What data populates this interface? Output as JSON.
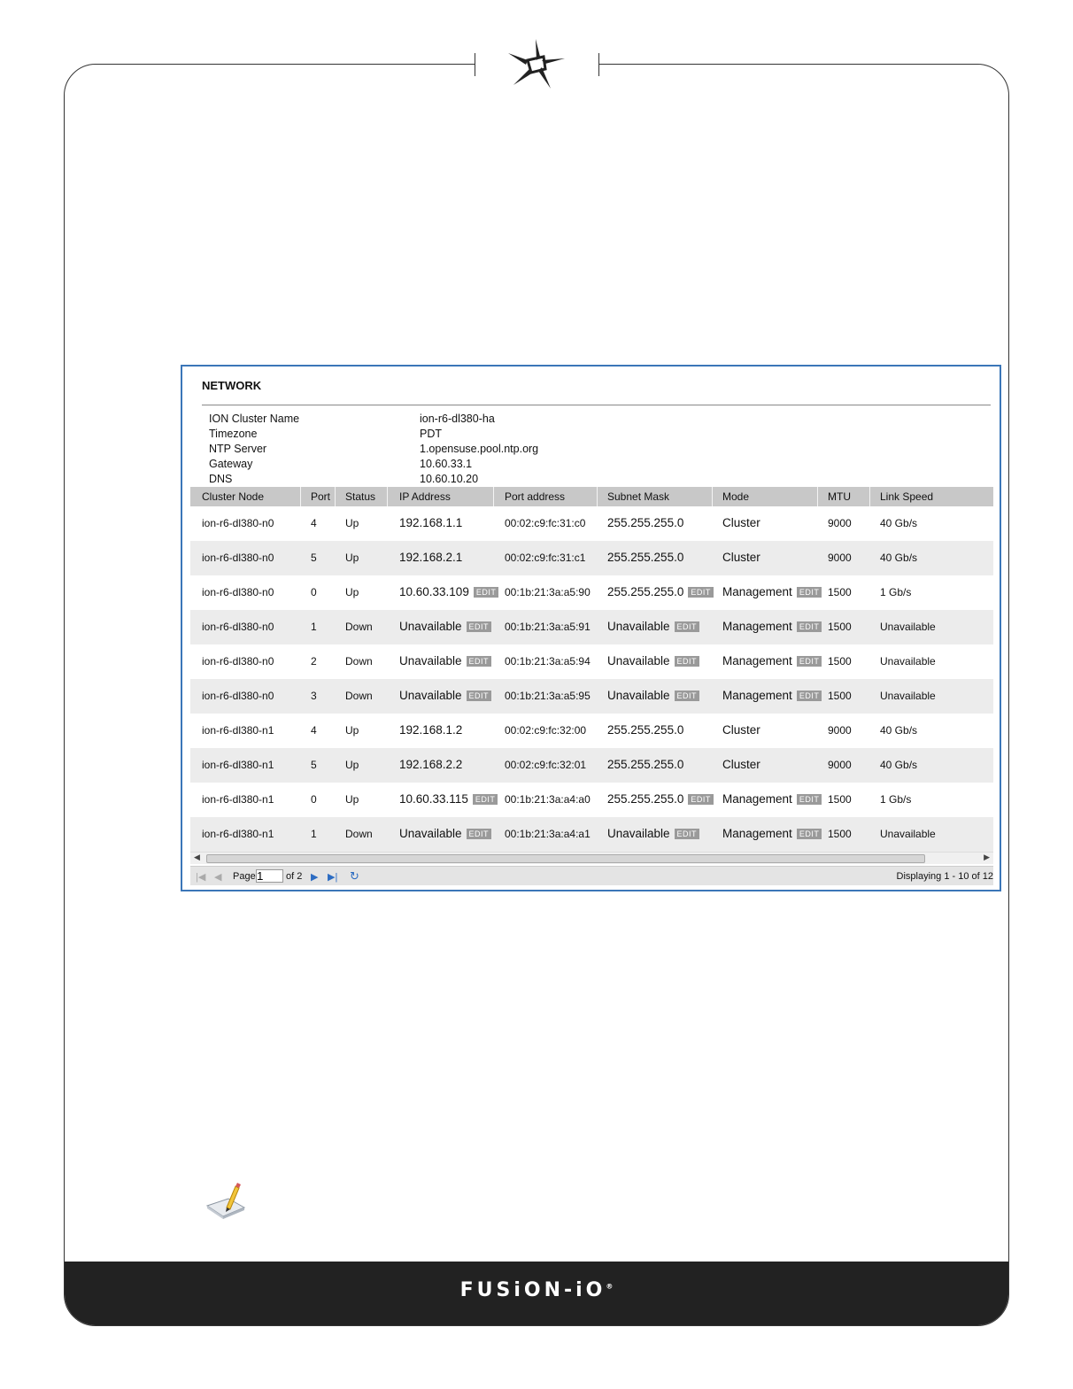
{
  "network": {
    "title": "NETWORK",
    "info": [
      {
        "label": "ION Cluster Name",
        "value": "ion-r6-dl380-ha"
      },
      {
        "label": "Timezone",
        "value": "PDT"
      },
      {
        "label": "NTP Server",
        "value": "1.opensuse.pool.ntp.org"
      },
      {
        "label": "Gateway",
        "value": "10.60.33.1"
      },
      {
        "label": "DNS",
        "value": "10.60.10.20"
      }
    ],
    "columns": [
      "Cluster Node",
      "Port",
      "Status",
      "IP Address",
      "Port address",
      "Subnet Mask",
      "Mode",
      "MTU",
      "Link Speed"
    ],
    "edit_label": "EDIT",
    "rows": [
      {
        "node": "ion-r6-dl380-n0",
        "port": "4",
        "status": "Up",
        "ip": "192.168.1.1",
        "mac": "00:02:c9:fc:31:c0",
        "mask": "255.255.255.0",
        "mode": "Cluster",
        "mtu": "9000",
        "speed": "40 Gb/s"
      },
      {
        "node": "ion-r6-dl380-n0",
        "port": "5",
        "status": "Up",
        "ip": "192.168.2.1",
        "mac": "00:02:c9:fc:31:c1",
        "mask": "255.255.255.0",
        "mode": "Cluster",
        "mtu": "9000",
        "speed": "40 Gb/s"
      },
      {
        "node": "ion-r6-dl380-n0",
        "port": "0",
        "status": "Up",
        "ip": "10.60.33.109",
        "mac": "00:1b:21:3a:a5:90",
        "mask": "255.255.255.0",
        "mode": "Management",
        "mtu": "1500",
        "speed": "1 Gb/s"
      },
      {
        "node": "ion-r6-dl380-n0",
        "port": "1",
        "status": "Down",
        "ip": "Unavailable",
        "mac": "00:1b:21:3a:a5:91",
        "mask": "Unavailable",
        "mode": "Management",
        "mtu": "1500",
        "speed": "Unavailable"
      },
      {
        "node": "ion-r6-dl380-n0",
        "port": "2",
        "status": "Down",
        "ip": "Unavailable",
        "mac": "00:1b:21:3a:a5:94",
        "mask": "Unavailable",
        "mode": "Management",
        "mtu": "1500",
        "speed": "Unavailable"
      },
      {
        "node": "ion-r6-dl380-n0",
        "port": "3",
        "status": "Down",
        "ip": "Unavailable",
        "mac": "00:1b:21:3a:a5:95",
        "mask": "Unavailable",
        "mode": "Management",
        "mtu": "1500",
        "speed": "Unavailable"
      },
      {
        "node": "ion-r6-dl380-n1",
        "port": "4",
        "status": "Up",
        "ip": "192.168.1.2",
        "mac": "00:02:c9:fc:32:00",
        "mask": "255.255.255.0",
        "mode": "Cluster",
        "mtu": "9000",
        "speed": "40 Gb/s"
      },
      {
        "node": "ion-r6-dl380-n1",
        "port": "5",
        "status": "Up",
        "ip": "192.168.2.2",
        "mac": "00:02:c9:fc:32:01",
        "mask": "255.255.255.0",
        "mode": "Cluster",
        "mtu": "9000",
        "speed": "40 Gb/s"
      },
      {
        "node": "ion-r6-dl380-n1",
        "port": "0",
        "status": "Up",
        "ip": "10.60.33.115",
        "mac": "00:1b:21:3a:a4:a0",
        "mask": "255.255.255.0",
        "mode": "Management",
        "mtu": "1500",
        "speed": "1 Gb/s"
      },
      {
        "node": "ion-r6-dl380-n1",
        "port": "1",
        "status": "Down",
        "ip": "Unavailable",
        "mac": "00:1b:21:3a:a4:a1",
        "mask": "Unavailable",
        "mode": "Management",
        "mtu": "1500",
        "speed": "Unavailable"
      }
    ],
    "pager": {
      "page_label": "Page",
      "page_value": "1",
      "of_label": "of 2",
      "display_text": "Displaying 1 - 10 of 12"
    }
  },
  "footer": {
    "logo_text": "FUSiON-iO",
    "registered": "®"
  },
  "icons": [
    "fusion-io-logo-icon",
    "note-pencil-icon",
    "first-page-icon",
    "prev-page-icon",
    "next-page-icon",
    "last-page-icon",
    "refresh-icon"
  ]
}
